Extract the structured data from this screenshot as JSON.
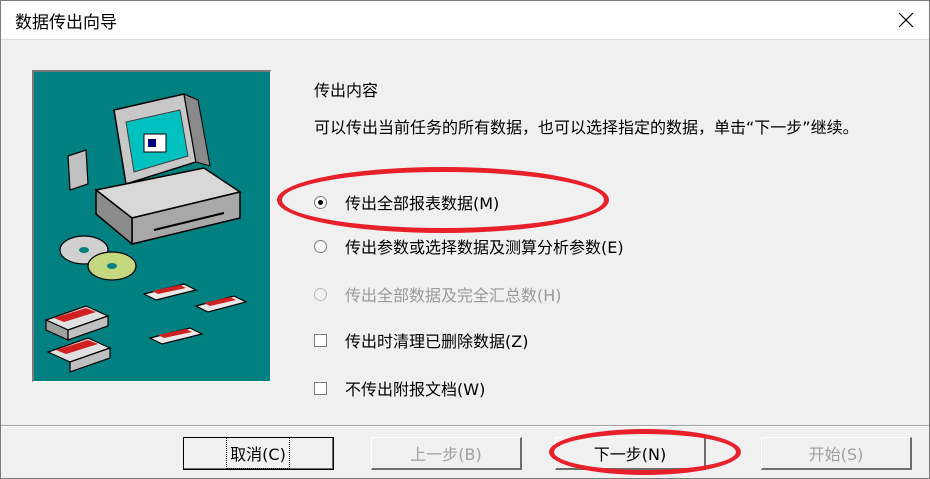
{
  "window": {
    "title": "数据传出向导"
  },
  "content": {
    "heading": "传出内容",
    "description": "可以传出当前任务的所有数据，也可以选择指定的数据，单击“下一步”继续。"
  },
  "options": [
    {
      "type": "radio",
      "label": "传出全部报表数据(M)",
      "checked": true,
      "enabled": true
    },
    {
      "type": "radio",
      "label": "传出参数或选择数据及测算分析参数(E)",
      "checked": false,
      "enabled": true
    },
    {
      "type": "radio",
      "label": "传出全部数据及完全汇总数(H)",
      "checked": false,
      "enabled": false
    },
    {
      "type": "checkbox",
      "label": "传出时清理已删除数据(Z)",
      "checked": false,
      "enabled": true
    },
    {
      "type": "checkbox",
      "label": "不传出附报文档(W)",
      "checked": false,
      "enabled": true
    }
  ],
  "buttons": {
    "cancel": "取消(C)",
    "back": "上一步(B)",
    "next": "下一步(N)",
    "start": "开始(S)"
  },
  "colors": {
    "annotation": "#e8202a",
    "picture_bg": "#008080"
  }
}
